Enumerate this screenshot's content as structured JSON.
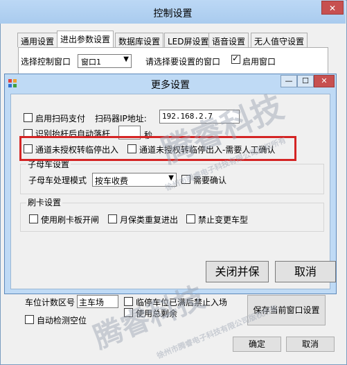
{
  "back_window": {
    "title": "控制设置",
    "close_glyph": "✕",
    "tabs": [
      "通用设置",
      "进出参数设置",
      "数据库设置",
      "LED屏设置",
      "语音设置",
      "无人值守设置"
    ],
    "active_tab": "进出参数设置",
    "select_window_label": "选择控制窗口",
    "select_window_value": "窗口1",
    "please_select_label": "请选择要设置的窗口",
    "enable_window_label": "启用窗口",
    "enable_window_checked": true,
    "space_counter_label": "车位计数区号",
    "space_counter_value": "主车场",
    "full_forbid_label": "临停车位已满后禁止入场",
    "use_total_label": "使用总剩余",
    "auto_detect_label": "自动检测空位",
    "save_window_button": "保存当前窗口设置",
    "ok_button": "确定",
    "cancel_button": "取消"
  },
  "dialog": {
    "title": "更多设置",
    "min_glyph": "—",
    "max_glyph": "☐",
    "close_glyph": "✕",
    "scan_pay_label": "启用扫码支付",
    "scanner_ip_label": "扫码器IP地址:",
    "scanner_ip_value": "192.168.2.7",
    "auto_gate_label": "识别抬杆后自动落杆",
    "seconds_label": "秒",
    "no_auth_label": "通道未授权转临停出入",
    "no_auth_manual_label": "通道未授权转临停出入-需要人工确认",
    "mother_group_label": "子母车设置",
    "mother_mode_label": "子母车处理模式",
    "mother_mode_value": "按车收费",
    "need_confirm_label": "需要确认",
    "card_group_label": "刷卡设置",
    "card_gate_label": "使用刷卡板开闸",
    "monthly_repeat_label": "月保类重复进出",
    "no_change_label": "禁止变更车型",
    "close_save_button": "关闭并保",
    "cancel_button": "取消"
  },
  "watermark": {
    "brand": "腾睿科技",
    "copyright": "徐州市腾睿电子科技有限公司版权所有"
  },
  "colors": {
    "highlight": "#d42424",
    "dialog_frame": "#bfdaf5",
    "close_button": "#c75050"
  }
}
